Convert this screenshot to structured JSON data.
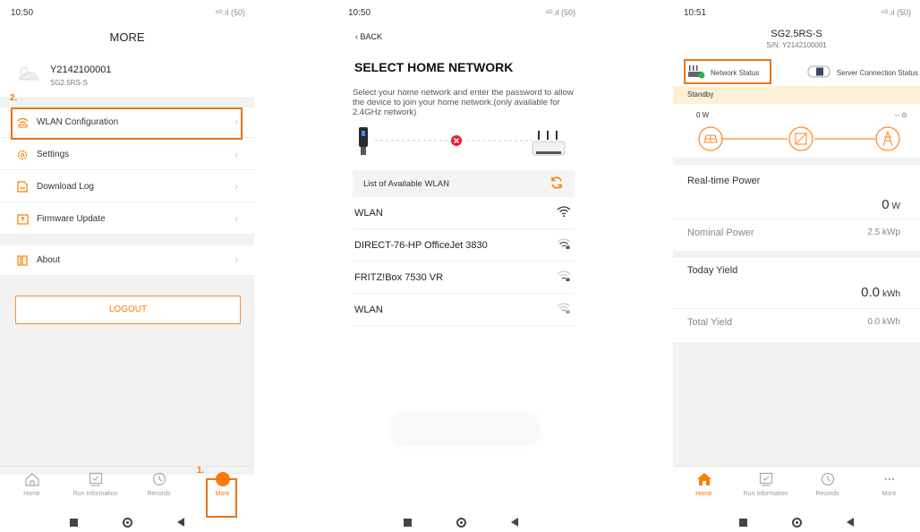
{
  "status": {
    "p1_time": "10:50",
    "p2_time": "10:50",
    "p3_time": "10:51",
    "right": "⁴ᴳ.ıl (50)"
  },
  "p1": {
    "title": "MORE",
    "user_name": "Y2142100001",
    "user_model": "SG2.5RS-S",
    "step1": "1.",
    "step2": "2.",
    "menu": [
      {
        "label": "WLAN Configuration",
        "icon": "wlan-icon"
      },
      {
        "label": "Settings",
        "icon": "settings-icon"
      },
      {
        "label": "Download Log",
        "icon": "download-log-icon"
      },
      {
        "label": "Firmware Update",
        "icon": "firmware-icon"
      },
      {
        "label": "About",
        "icon": "about-icon"
      }
    ],
    "logout": "LOGOUT"
  },
  "tabs": [
    {
      "label": "Home",
      "icon": "home-icon"
    },
    {
      "label": "Run Information",
      "icon": "run-information-icon"
    },
    {
      "label": "Records",
      "icon": "records-icon"
    },
    {
      "label": "More",
      "icon": "more-icon"
    }
  ],
  "p2": {
    "back": "BACK",
    "title": "SELECT HOME NETWORK",
    "description": "Select your home network and enter the password to allow the device to join your home network.(only available for 2.4GHz network)",
    "list_header": "List of Available WLAN",
    "networks": [
      {
        "ssid": "WLAN",
        "signal": "strong",
        "locked": false
      },
      {
        "ssid": "DIRECT-76-HP OfficeJet 3830",
        "signal": "medium",
        "locked": true
      },
      {
        "ssid": "FRITZ!Box 7530 VR",
        "signal": "medium",
        "locked": true
      },
      {
        "ssid": "WLAN",
        "signal": "weak",
        "locked": true
      }
    ]
  },
  "p3": {
    "title": "SG2.5RS-S",
    "serial": "S/N: Y2142100001",
    "network_status": "Network Status",
    "server_status": "Server Connection Status",
    "standby": "Standby",
    "pv_power": "0 W",
    "grid_power": "-- ⊙",
    "metrics": {
      "realtime_label": "Real-time Power",
      "realtime_value": "0",
      "realtime_unit": "W",
      "nominal_label": "Nominal Power",
      "nominal_value": "2.5 kWp",
      "today_label": "Today Yield",
      "today_value": "0.0",
      "today_unit": "kWh",
      "total_label": "Total Yield",
      "total_value": "0.0 kWh"
    }
  },
  "colors": {
    "accent": "#ff7a00",
    "highlight": "#e8761b",
    "error": "#e8202a",
    "standby_bg": "#fdf0d8"
  }
}
